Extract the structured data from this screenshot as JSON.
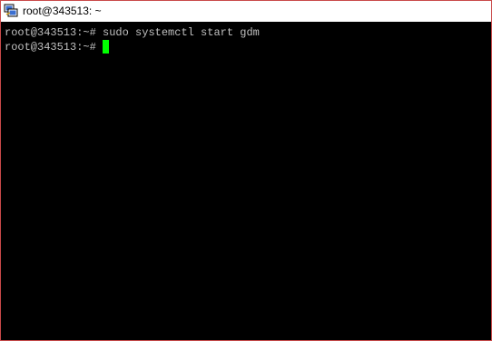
{
  "window": {
    "title": "root@343513: ~",
    "icon": "putty-icon"
  },
  "terminal": {
    "lines": [
      {
        "prompt": "root@343513:~#",
        "command": "sudo systemctl start gdm"
      },
      {
        "prompt": "root@343513:~#",
        "command": ""
      }
    ],
    "cursor_color": "#00ff00",
    "background": "#000000",
    "foreground": "#c0c0c0"
  }
}
